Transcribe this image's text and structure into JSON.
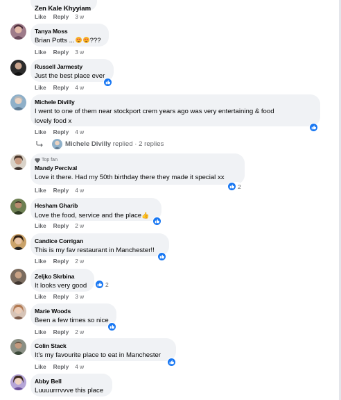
{
  "comments": [
    {
      "author": "Zen Kale Khyyiam",
      "text": "",
      "time": "3 w"
    },
    {
      "author": "Tanya Moss",
      "text": "Brian Potts ...",
      "text_suffix": "???",
      "time": "3 w"
    },
    {
      "author": "Russell Jarmesty",
      "text": "Just the best place ever",
      "time": "4 w",
      "reaction": ""
    },
    {
      "author": "Michele Divilly",
      "text_line1": "I went to one of them near stockport crem years ago was very entertaining & food",
      "text_line2": "lovely food x",
      "time": "4 w",
      "reaction": ""
    },
    {
      "author": "Mandy Percival",
      "badge": "Top fan",
      "text": "Love it there. Had my 50th birthday there they made it special xx",
      "time": "4 w",
      "reaction": "2"
    },
    {
      "author": "Hesham Gharib",
      "text": "Love the food, service and the place",
      "text_suffix": "👍",
      "time": "2 w",
      "reaction": ""
    },
    {
      "author": "Candice Corrigan",
      "text": "This is my fav restaurant in Manchester!!",
      "time": "2 w",
      "reaction": ""
    },
    {
      "author": "Zeljko Skrbina",
      "text": "It looks very good",
      "time": "3 w",
      "reaction": "2"
    },
    {
      "author": "Marie Woods",
      "text": "Been a few times so nice",
      "time": "2 w",
      "reaction": ""
    },
    {
      "author": "Colin Stack",
      "text": "It's my favourite place to eat in Manchester",
      "time": "4 w",
      "reaction": ""
    },
    {
      "author": "Abby Bell",
      "text": "Luuuurrrvvve this place",
      "time": ""
    }
  ],
  "actions": {
    "like": "Like",
    "reply": "Reply"
  },
  "reply_link": {
    "author": "Michele Divilly",
    "text": "replied · 2 replies"
  },
  "colors": {
    "accent": "#1877f2",
    "bubble": "#f0f2f5",
    "meta": "#65676b"
  },
  "icons": [
    "reply-arrow-icon",
    "like-reaction-icon",
    "top-fan-icon",
    "heart-eyes-emoji-icon",
    "thumbs-up-emoji-icon"
  ]
}
